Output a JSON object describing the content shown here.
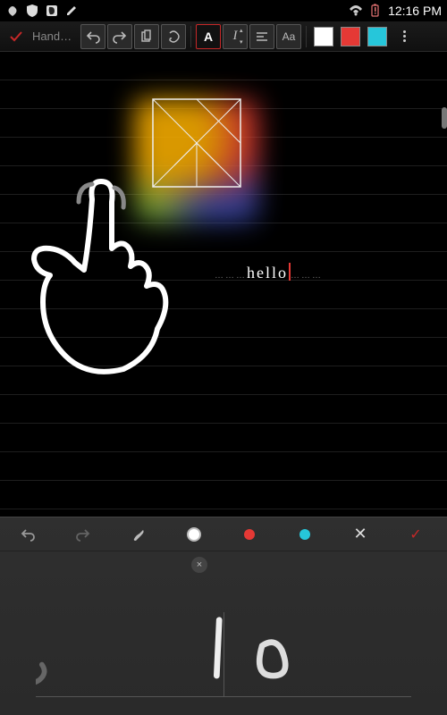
{
  "status": {
    "time": "12:16 PM",
    "icons": [
      "jellybean",
      "shield",
      "evernote",
      "pencil",
      "wifi",
      "battery-alert"
    ]
  },
  "toolbar": {
    "confirm_icon": "check",
    "breadcrumb": "Handw…",
    "buttons": {
      "undo": "undo-icon",
      "redo": "redo-icon",
      "clipboard": "clipboard-icon",
      "lasso": "lasso-icon",
      "text_A": "A",
      "italic": "I",
      "align": "align-left-icon",
      "font": "Aa",
      "swatches": [
        "white",
        "red",
        "teal"
      ],
      "overflow": "kebab"
    },
    "active_tool": "text_A"
  },
  "canvas": {
    "typed_text": "hello",
    "text_field_dots": "………",
    "cursor_visible": true
  },
  "handwrite_panel": {
    "buttons": [
      "undo",
      "redo",
      "brush",
      "color-white",
      "color-red",
      "color-teal",
      "cancel",
      "confirm"
    ],
    "active_color": "white",
    "clear_chip": "×",
    "strokes_preview": "lo"
  }
}
